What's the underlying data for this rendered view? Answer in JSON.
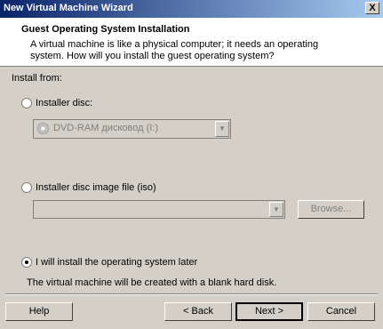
{
  "window": {
    "title": "New Virtual Machine Wizard",
    "close_glyph": "X"
  },
  "header": {
    "title": "Guest Operating System Installation",
    "description": "A virtual machine is like a physical computer; it needs an operating system. How will you install the guest operating system?"
  },
  "install_from": {
    "label": "Install from:",
    "options": [
      {
        "label": "Installer disc:",
        "selected": false
      },
      {
        "label": "Installer disc image file (iso)",
        "selected": false
      },
      {
        "label": "I will install the operating system later",
        "selected": true
      }
    ],
    "disc_dropdown_value": "DVD-RAM дисковод (I:)",
    "iso_dropdown_value": "",
    "browse_label": "Browse...",
    "later_note": "The virtual machine will be created with a blank hard disk."
  },
  "footer": {
    "help": "Help",
    "back": "< Back",
    "next": "Next >",
    "cancel": "Cancel"
  }
}
